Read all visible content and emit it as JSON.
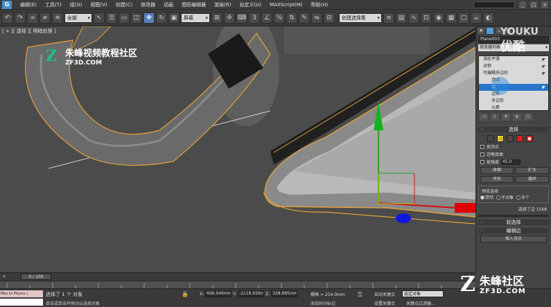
{
  "menubar": {
    "logo": "G",
    "items": [
      "编辑(E)",
      "工具(T)",
      "组(G)",
      "视图(V)",
      "创建(C)",
      "修改器",
      "动画",
      "图形编辑器",
      "渲染(R)",
      "自定义(U)",
      "MAXScript(M)",
      "帮助(H)"
    ]
  },
  "toolbar": {
    "filter_value": "全部",
    "coord_value": "屏幕",
    "selection_set_placeholder": "创建选择集",
    "snap_label": "3"
  },
  "viewport": {
    "label": "[ + ][ 透视 ][ 明暗处理 ]",
    "watermark_cn": "朱峰视频教程社区",
    "watermark_en": "ZF3D.COM"
  },
  "command_panel": {
    "object_name": "Plane003",
    "modifier_list": "修改器列表",
    "stack": [
      {
        "label": "涡轮平滑",
        "level": 0
      },
      {
        "label": "对称",
        "level": 0
      },
      {
        "label": "可编辑多边形",
        "level": 0
      },
      {
        "label": "顶点",
        "level": 1
      },
      {
        "label": "边",
        "level": 1
      },
      {
        "label": "边界",
        "level": 1
      },
      {
        "label": "多边形",
        "level": 1
      },
      {
        "label": "元素",
        "level": 1
      }
    ],
    "selected_stack_item": "边",
    "rollout_select": "选择",
    "by_vertex": "按顶点",
    "ignore_backfacing": "忽略背面",
    "by_angle": "按角度",
    "angle_value": "45.0",
    "shrink": "收缩",
    "grow": "扩大",
    "ring": "环形",
    "loop": "循环",
    "preview_selection": "预览选择",
    "preview_options": [
      "禁用",
      "子对象",
      "多个"
    ],
    "preview_selected": "禁用",
    "selection_info": "选择了边 1568",
    "soft_selection": "软选择",
    "edit_edges": "编辑边",
    "insert_vertex": "插入顶点"
  },
  "youku": {
    "line1": "YOUKU",
    "line2": "优酷"
  },
  "timeline": {
    "frame": "0 / 100"
  },
  "statusbar": {
    "script_listener": "Max to Physcs (",
    "selection_text": "选择了 1 个 对象",
    "prompt_text": "单击或单击并拖动以选择对象",
    "x_label": "X:",
    "x_value": "666.946mm",
    "y_label": "Y:",
    "y_value": "-2116.656mm",
    "z_label": "Z:",
    "z_value": "328.885mm",
    "grid": "栅格 = 254.0mm",
    "add_time_tag": "添加时间标记",
    "auto_key": "自动关键点",
    "set_key": "设置关键点",
    "selected_object": "选定对象",
    "key_filters": "关键点过滤器..."
  },
  "watermark_bottom": {
    "cn": "朱峰社区",
    "en": "ZF3D.COM"
  }
}
